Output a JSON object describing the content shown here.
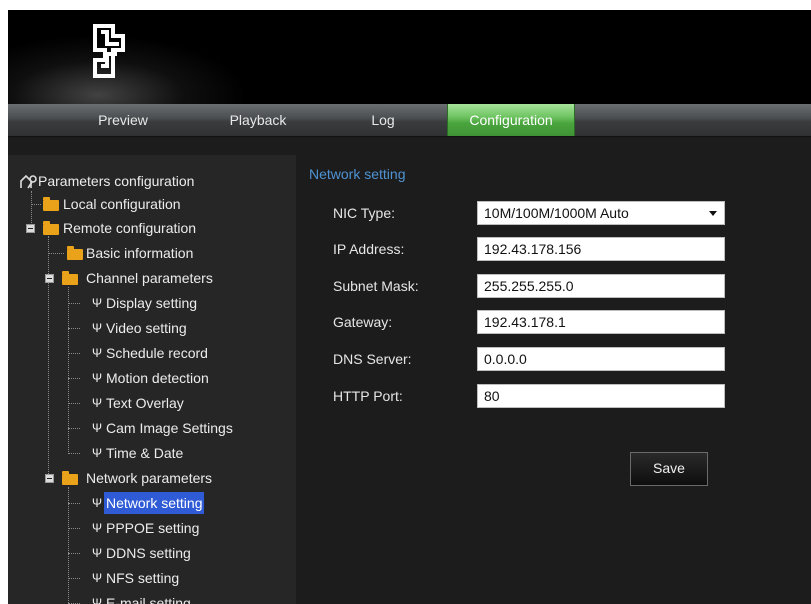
{
  "tabs": [
    {
      "label": "Preview"
    },
    {
      "label": "Playback"
    },
    {
      "label": "Log"
    },
    {
      "label": "Configuration",
      "active": true
    }
  ],
  "tree": {
    "root": "Parameters configuration",
    "local": "Local configuration",
    "remote": "Remote configuration",
    "basic": "Basic information",
    "channel": "Channel parameters",
    "channel_items": [
      "Display setting",
      "Video setting",
      "Schedule record",
      "Motion detection",
      "Text Overlay",
      "Cam Image Settings",
      "Time & Date"
    ],
    "network": "Network parameters",
    "network_items": [
      "Network setting",
      "PPPOE setting",
      "DDNS setting",
      "NFS setting",
      "E-mail setting"
    ],
    "selected": "Network setting"
  },
  "main": {
    "title": "Network setting",
    "fields": [
      {
        "label": "NIC Type:",
        "value": "10M/100M/1000M Auto",
        "type": "select"
      },
      {
        "label": "IP Address:",
        "value": "192.43.178.156"
      },
      {
        "label": "Subnet Mask:",
        "value": "255.255.255.0"
      },
      {
        "label": "Gateway:",
        "value": "192.43.178.1"
      },
      {
        "label": "DNS Server:",
        "value": "0.0.0.0"
      },
      {
        "label": "HTTP Port:",
        "value": "80"
      }
    ],
    "save_label": "Save"
  },
  "colors": {
    "active_tab": "#6fc462",
    "section_title": "#4f93d3",
    "selection": "#2f5bd6",
    "folder": "#e9a21a"
  },
  "icons": {
    "logo": "brand-logo-icon",
    "root": "parameters-config-icon",
    "folder": "folder-icon",
    "leaf": "wrench-icon"
  }
}
